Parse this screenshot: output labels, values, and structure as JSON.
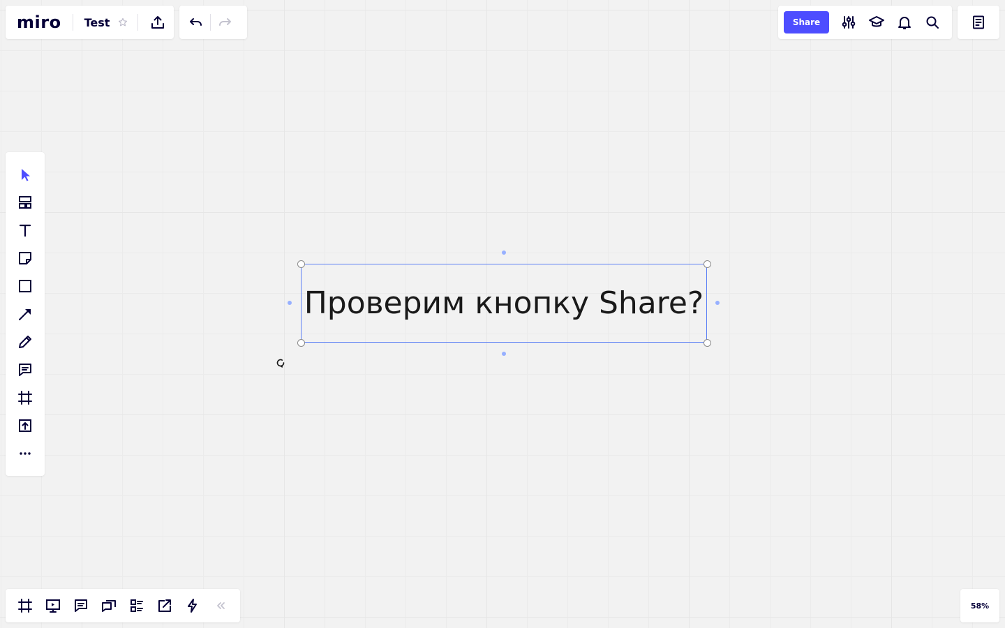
{
  "app": {
    "logo": "miro"
  },
  "board": {
    "title": "Test"
  },
  "header": {
    "share_label": "Share"
  },
  "canvas": {
    "text": "Проверим кнопку Share?"
  },
  "zoom": {
    "level": "58%"
  },
  "colors": {
    "accent": "#4d4dff",
    "selection": "#5b7ff5",
    "canvas": "#f2f2f2",
    "text": "#050038"
  },
  "toolbar": {
    "tools": [
      "select-tool",
      "templates-tool",
      "text-tool",
      "sticky-note-tool",
      "shape-tool",
      "line-tool",
      "pen-tool",
      "comment-tool",
      "frame-tool",
      "upload-tool",
      "more-tools"
    ]
  },
  "bottom_bar": {
    "tools": [
      "frames-icon",
      "presentation-icon",
      "comments-icon",
      "video-chat-icon",
      "cards-icon",
      "screen-share-icon",
      "lightning-icon",
      "collapse-icon"
    ]
  }
}
